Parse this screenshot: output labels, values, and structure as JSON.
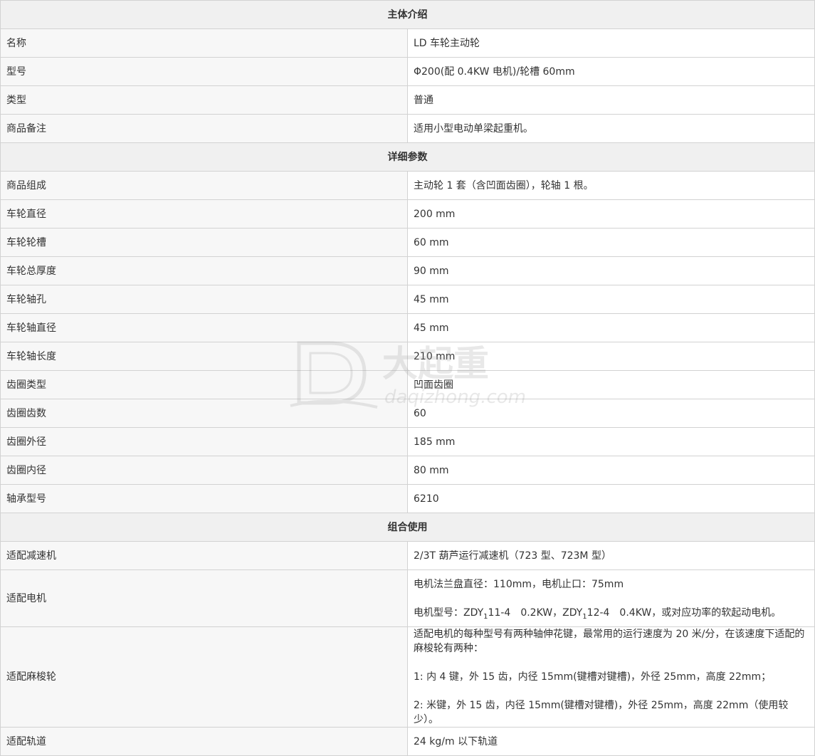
{
  "sections": {
    "intro": "主体介绍",
    "detail": "详细参数",
    "combo": "组合使用"
  },
  "intro_rows": [
    {
      "key": "名称",
      "value": "LD 车轮主动轮"
    },
    {
      "key": "型号",
      "value": "Φ200(配 0.4KW 电机)/轮槽 60mm"
    },
    {
      "key": "类型",
      "value": "普通"
    },
    {
      "key": "商品备注",
      "value": "适用小型电动单梁起重机。"
    }
  ],
  "detail_rows": [
    {
      "key": "商品组成",
      "value": "主动轮 1 套（含凹面齿圈），轮轴 1 根。"
    },
    {
      "key": "车轮直径",
      "value": "200 mm"
    },
    {
      "key": "车轮轮槽",
      "value": "60 mm"
    },
    {
      "key": "车轮总厚度",
      "value": "90 mm"
    },
    {
      "key": "车轮轴孔",
      "value": "45 mm"
    },
    {
      "key": "车轮轴直径",
      "value": "45 mm"
    },
    {
      "key": "车轮轴长度",
      "value": "210 mm"
    },
    {
      "key": "齿圈类型",
      "value": "凹面齿圈"
    },
    {
      "key": "齿圈齿数",
      "value": "60"
    },
    {
      "key": "齿圈外径",
      "value": "185 mm"
    },
    {
      "key": "齿圈内径",
      "value": "80 mm"
    },
    {
      "key": "轴承型号",
      "value": "6210"
    }
  ],
  "combo": {
    "reducer_key": "适配减速机",
    "reducer_value": "2/3T 葫芦运行减速机（723 型、723M 型）",
    "motor_key": "适配电机",
    "motor_line1": "电机法兰盘直径：110mm，电机止口：75mm",
    "motor_line2_a": "电机型号：ZDY",
    "motor_sub1": "1",
    "motor_line2_b": "11-4　0.2KW，ZDY",
    "motor_sub2": "1",
    "motor_line2_c": "12-4　0.4KW，或对应功率的软起动电机。",
    "gear_key": "适配麻梭轮",
    "gear_line1": "适配电机的每种型号有两种轴伸花键，最常用的运行速度为 20 米/分，在该速度下适配的麻梭轮有两种：",
    "gear_line2": "1:  内 4 键，外 15 齿，内径 15mm(键槽对键槽)，外径 25mm，高度 22mm；",
    "gear_line3": "2:  米键，外 15 齿，内径 15mm(键槽对键槽)，外径 25mm，高度 22mm（使用较少）。",
    "rail_key": "适配轨道",
    "rail_value": "24 kg/m 以下轨道"
  },
  "watermark": {
    "logo_icon": "dqz-logo-icon",
    "brand_cn": "大起重",
    "brand_url": "daqizhong.com"
  }
}
